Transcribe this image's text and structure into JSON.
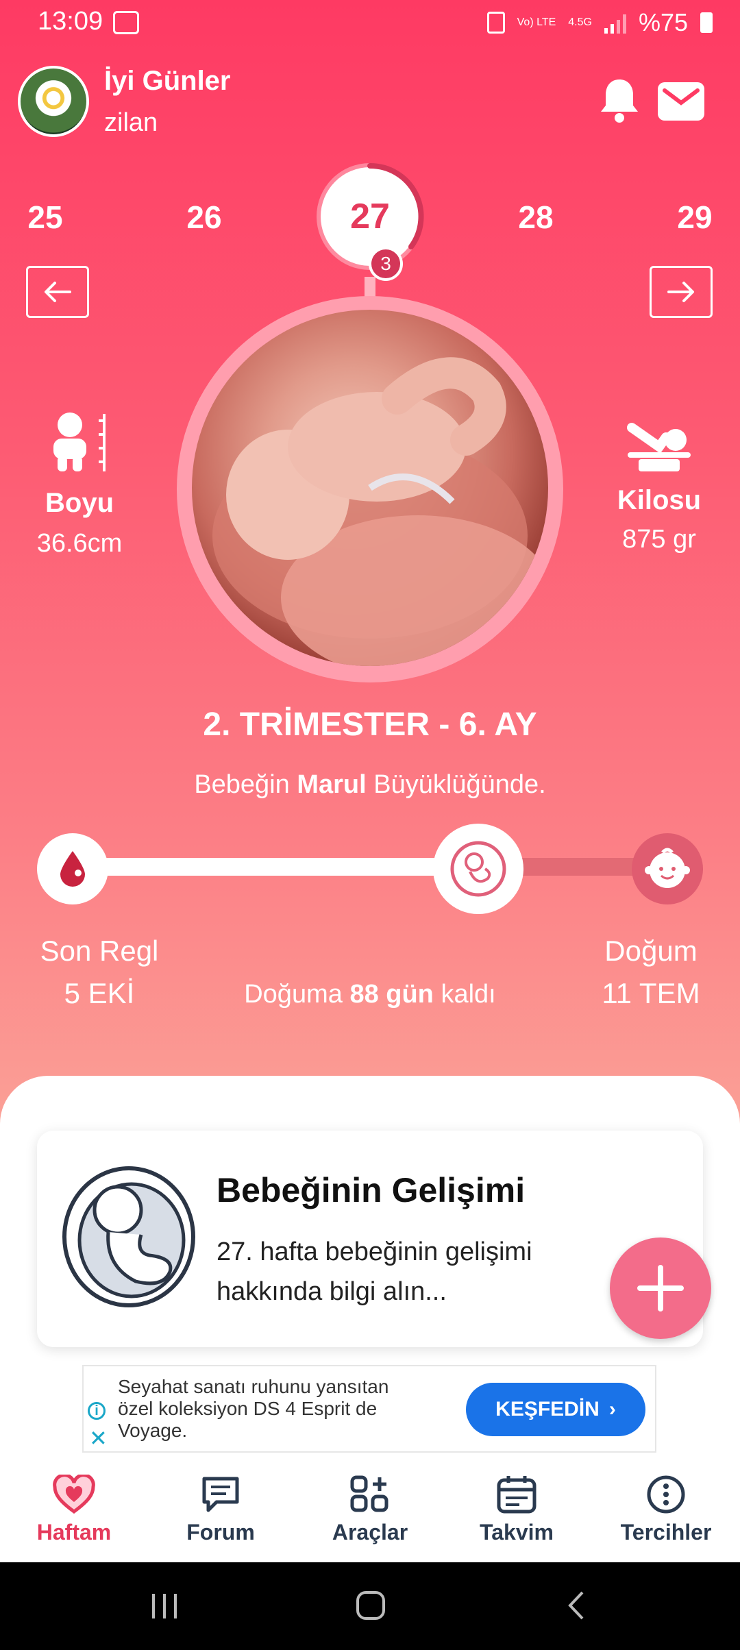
{
  "status_bar": {
    "time": "13:09",
    "network": "Vo) LTE",
    "network_type": "4.5G",
    "battery": "%75"
  },
  "header": {
    "greeting": "İyi Günler",
    "username": "zilan"
  },
  "weeks": {
    "prev2": "25",
    "prev1": "26",
    "current": "27",
    "next1": "28",
    "next2": "29",
    "trimester_badge": "3"
  },
  "stats": {
    "height_label": "Boyu",
    "height_value": "36.6cm",
    "weight_label": "Kilosu",
    "weight_value": "875 gr"
  },
  "trimester_title": "2. TRİMESTER - 6. AY",
  "size_text": {
    "prefix": "Bebeğin",
    "fruit": "Marul",
    "suffix": "Büyüklüğünde."
  },
  "progress": {
    "start_label": "Son Regl",
    "start_date": "5 EKİ",
    "end_label": "Doğum",
    "end_date": "11 TEM",
    "remaining_prefix": "Doğuma",
    "remaining_days": "88 gün",
    "remaining_suffix": "kaldı",
    "fraction_elapsed": 0.68
  },
  "card": {
    "title": "Bebeğinin Gelişimi",
    "description": "27. hafta bebeğinin gelişimi hakkında bilgi alın..."
  },
  "ad": {
    "text": "Seyahat sanatı ruhunu yansıtan özel koleksiyon DS 4 Esprit de Voyage.",
    "button": "KEŞFEDİN"
  },
  "nav": [
    {
      "label": "Haftam",
      "icon": "heart-icon"
    },
    {
      "label": "Forum",
      "icon": "chat-icon"
    },
    {
      "label": "Araçlar",
      "icon": "tools-icon"
    },
    {
      "label": "Takvim",
      "icon": "calendar-icon"
    },
    {
      "label": "Tercihler",
      "icon": "more-icon"
    }
  ],
  "colors": {
    "primary": "#fe3a63",
    "accent_dark": "#d43658",
    "fab": "#f36c8a",
    "ad_button": "#1a73e8"
  }
}
